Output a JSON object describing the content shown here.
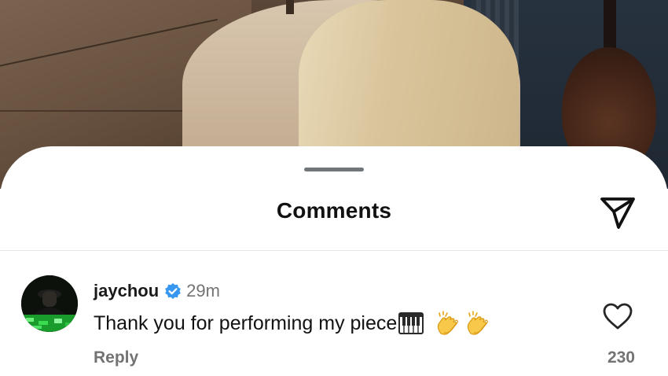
{
  "sheet": {
    "title": "Comments",
    "share_icon": "send-paper-plane-icon",
    "grabber_icon": "drag-handle-icon"
  },
  "comment": {
    "username": "jaychou",
    "verified_icon": "verified-badge-icon",
    "time": "29m",
    "text": "Thank you for performing my piece",
    "emojis": [
      "musical-keyboard-icon",
      "clapping-hands-icon",
      "clapping-hands-icon"
    ],
    "reply_label": "Reply",
    "like_icon": "heart-outline-icon",
    "like_count": "230"
  },
  "colors": {
    "accent_verified": "#3897f0",
    "muted_text": "#737373",
    "primary_text": "#121212"
  }
}
